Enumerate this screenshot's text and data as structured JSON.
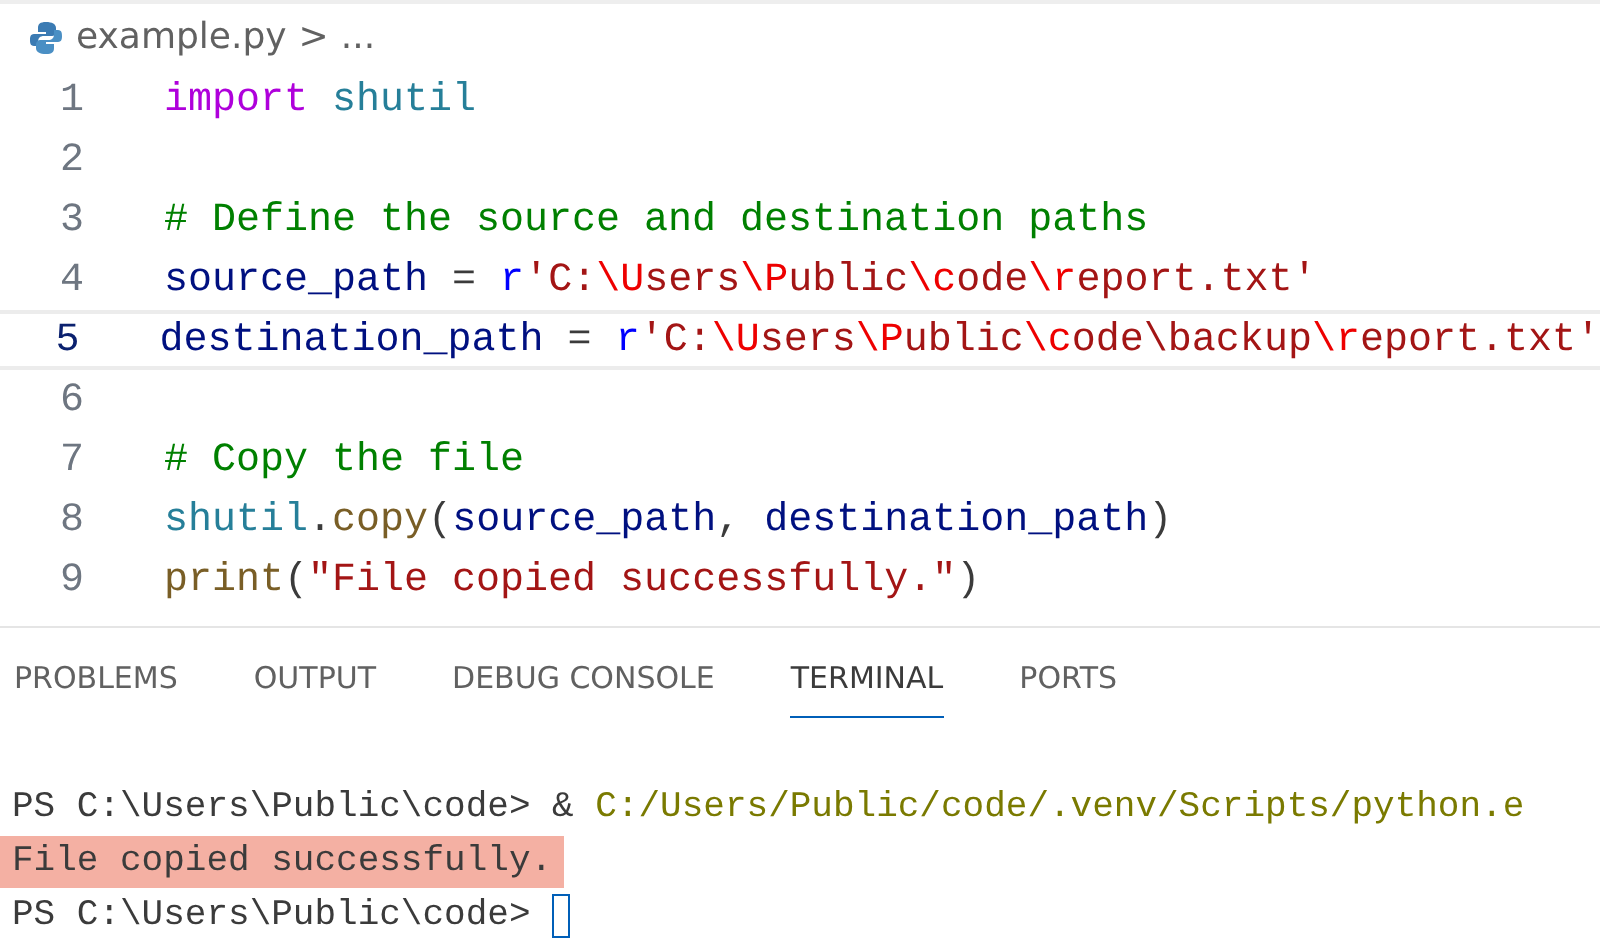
{
  "breadcrumb": {
    "file": "example.py",
    "separator": ">",
    "more": "..."
  },
  "editor": {
    "lines": [
      {
        "number": "1",
        "current": false,
        "tokens": [
          {
            "kind": "keyword",
            "text": "import "
          },
          {
            "kind": "module",
            "text": "shutil"
          }
        ]
      },
      {
        "number": "2",
        "current": false
      },
      {
        "number": "3",
        "current": false,
        "tokens": [
          {
            "kind": "comment",
            "text": "# Define the source and destination paths"
          }
        ]
      },
      {
        "number": "4",
        "current": false,
        "tokens": [
          {
            "kind": "variable",
            "text": "source_path"
          },
          {
            "kind": "plain",
            "text": " = "
          },
          {
            "kind": "prefix",
            "text": "r"
          },
          {
            "kind": "string",
            "text": "'C:"
          },
          {
            "kind": "escape",
            "text": "\\U"
          },
          {
            "kind": "string",
            "text": "sers"
          },
          {
            "kind": "escape",
            "text": "\\P"
          },
          {
            "kind": "string",
            "text": "ublic"
          },
          {
            "kind": "escape",
            "text": "\\c"
          },
          {
            "kind": "string",
            "text": "ode"
          },
          {
            "kind": "escape",
            "text": "\\r"
          },
          {
            "kind": "string",
            "text": "eport.txt'"
          }
        ]
      },
      {
        "number": "5",
        "current": true,
        "tokens": [
          {
            "kind": "variable",
            "text": "destination_path"
          },
          {
            "kind": "plain",
            "text": " = "
          },
          {
            "kind": "prefix",
            "text": "r"
          },
          {
            "kind": "string",
            "text": "'C:"
          },
          {
            "kind": "escape",
            "text": "\\U"
          },
          {
            "kind": "string",
            "text": "sers"
          },
          {
            "kind": "escape",
            "text": "\\P"
          },
          {
            "kind": "string",
            "text": "ublic"
          },
          {
            "kind": "escape",
            "text": "\\c"
          },
          {
            "kind": "string",
            "text": "ode\\backup"
          },
          {
            "kind": "escape",
            "text": "\\r"
          },
          {
            "kind": "string",
            "text": "eport.txt'"
          }
        ]
      },
      {
        "number": "6",
        "current": false
      },
      {
        "number": "7",
        "current": false,
        "tokens": [
          {
            "kind": "comment",
            "text": "# Copy the file"
          }
        ]
      },
      {
        "number": "8",
        "current": false,
        "tokens": [
          {
            "kind": "module",
            "text": "shutil"
          },
          {
            "kind": "plain",
            "text": "."
          },
          {
            "kind": "function",
            "text": "copy"
          },
          {
            "kind": "plain",
            "text": "("
          },
          {
            "kind": "variable",
            "text": "source_path"
          },
          {
            "kind": "plain",
            "text": ", "
          },
          {
            "kind": "variable",
            "text": "destination_path"
          },
          {
            "kind": "plain",
            "text": ")"
          }
        ]
      },
      {
        "number": "9",
        "current": false,
        "tokens": [
          {
            "kind": "function",
            "text": "print"
          },
          {
            "kind": "plain",
            "text": "("
          },
          {
            "kind": "string",
            "text": "\"File copied successfully.\""
          },
          {
            "kind": "plain",
            "text": ")"
          }
        ]
      }
    ]
  },
  "panel": {
    "tabs": [
      {
        "label": "PROBLEMS",
        "selected": false
      },
      {
        "label": "OUTPUT",
        "selected": false
      },
      {
        "label": "DEBUG CONSOLE",
        "selected": false
      },
      {
        "label": "TERMINAL",
        "selected": true
      },
      {
        "label": "PORTS",
        "selected": false
      }
    ],
    "terminal": [
      {
        "highlighted": false,
        "cursor": false,
        "segments": [
          {
            "kind": "plain",
            "text": "PS C:\\Users\\Public\\code> & "
          },
          {
            "kind": "path",
            "text": "C:/Users/Public/code/.venv/Scripts/python.e"
          }
        ]
      },
      {
        "highlighted": true,
        "cursor": false,
        "segments": [
          {
            "kind": "plain",
            "text": "File copied successfully."
          }
        ]
      },
      {
        "highlighted": false,
        "cursor": true,
        "segments": [
          {
            "kind": "plain",
            "text": "PS C:\\Users\\Public\\code> "
          }
        ]
      }
    ]
  }
}
